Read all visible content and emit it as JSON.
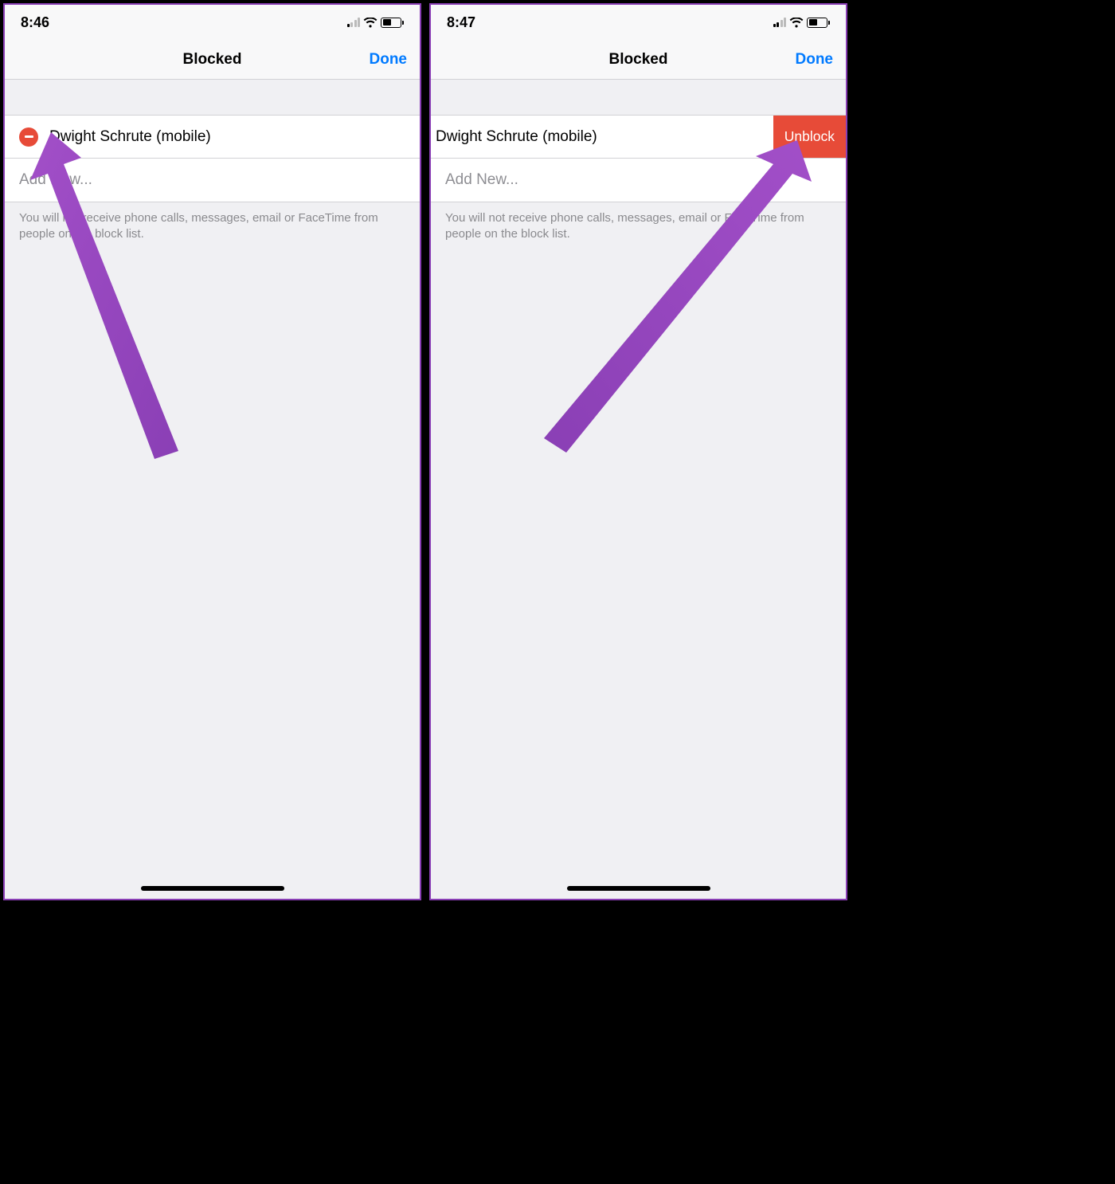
{
  "left": {
    "status": {
      "time": "8:46",
      "signal_active_bars": 1,
      "battery_pct": 50
    },
    "nav": {
      "title": "Blocked",
      "done": "Done"
    },
    "contact": {
      "name": "Dwight Schrute (mobile)"
    },
    "addnew": "Add New...",
    "footer": "You will not receive phone calls, messages, email or FaceTime from people on the block list."
  },
  "right": {
    "status": {
      "time": "8:47",
      "signal_active_bars": 2,
      "battery_pct": 50
    },
    "nav": {
      "title": "Blocked",
      "done": "Done"
    },
    "contact": {
      "name": "Dwight Schrute (mobile)",
      "unblock": "Unblock"
    },
    "addnew": "Add New...",
    "footer": "You will not receive phone calls, messages, email or FaceTime from people on the block list."
  }
}
